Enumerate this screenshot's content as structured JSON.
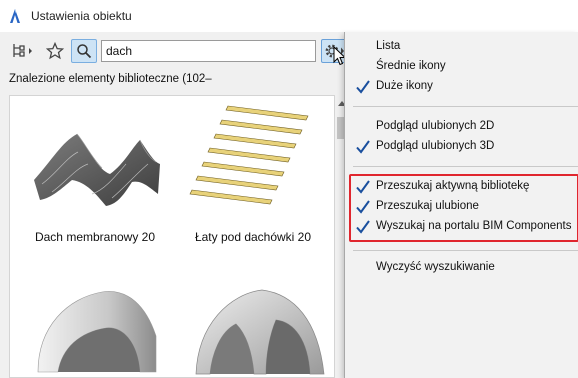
{
  "window": {
    "title": "Ustawienia obiektu"
  },
  "toolbar": {
    "search_value": "dach",
    "search_placeholder": ""
  },
  "results": {
    "label": "Znalezione elementy biblioteczne (102–",
    "items": [
      {
        "label": "Dach membranowy 20"
      },
      {
        "label": "Łaty pod dachówki 20"
      },
      {
        "label": ""
      },
      {
        "label": ""
      }
    ]
  },
  "menu": {
    "items": [
      {
        "label": "Lista",
        "checked": false
      },
      {
        "label": "Średnie ikony",
        "checked": false
      },
      {
        "label": "Duże ikony",
        "checked": true
      },
      {
        "label": "Podgląd ulubionych 2D",
        "checked": false
      },
      {
        "label": "Podgląd ulubionych 3D",
        "checked": true
      },
      {
        "label": "Przeszukaj aktywną bibliotekę",
        "checked": true
      },
      {
        "label": "Przeszukaj ulubione",
        "checked": true
      },
      {
        "label": "Wyszukaj na portalu BIM Components",
        "checked": true
      },
      {
        "label": "Wyczyść wyszukiwanie",
        "checked": false
      }
    ]
  },
  "colors": {
    "accent_blue": "#1a4f9e",
    "highlight_red": "#e0262e",
    "selected_button_bg": "#cde3f5"
  },
  "icons": {
    "app": "archicad-logo-icon",
    "navigator": "navigator-tree-icon",
    "favorites": "star-icon",
    "search": "magnifier-icon",
    "settings": "gear-icon",
    "check": "checkmark-icon"
  }
}
